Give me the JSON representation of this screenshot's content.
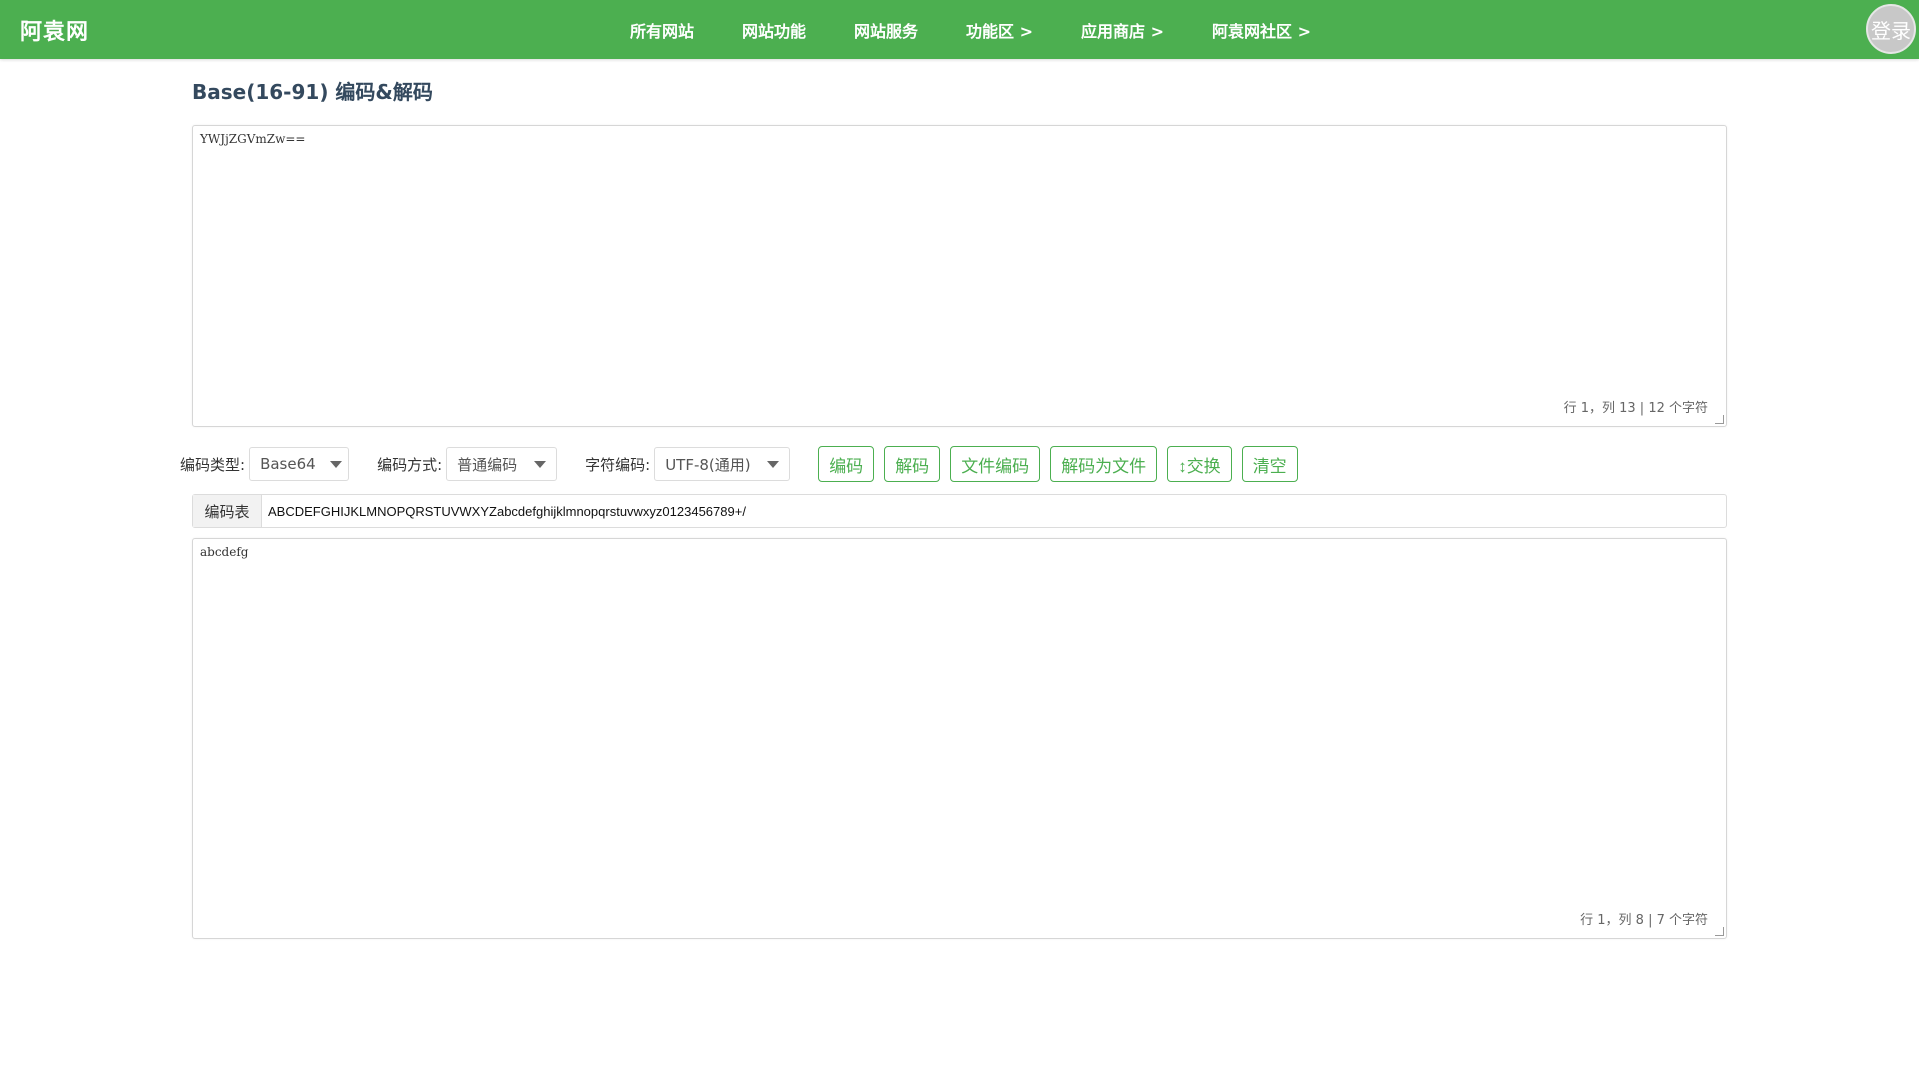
{
  "header": {
    "brand": "阿袁网",
    "nav": [
      "所有网站",
      "网站功能",
      "网站服务",
      "功能区 >",
      "应用商店 >",
      "阿袁网社区 >"
    ],
    "login_label": "登录"
  },
  "page": {
    "title": "Base(16-91) 编码&解码"
  },
  "input": {
    "value": "YWJjZGVmZw==",
    "status": "行 1，列 13 | 12 个字符"
  },
  "controls": {
    "encoding_type_label": "编码类型:",
    "encoding_type_value": "Base64",
    "encoding_method_label": "编码方式:",
    "encoding_method_value": "普通编码",
    "charset_label": "字符编码:",
    "charset_value": "UTF-8(通用)",
    "buttons": {
      "encode": "编码",
      "decode": "解码",
      "file_encode": "文件编码",
      "decode_to_file": "解码为文件",
      "swap": "↕交换",
      "clear": "清空"
    }
  },
  "alphabet": {
    "label": "编码表",
    "value": "ABCDEFGHIJKLMNOPQRSTUVWXYZabcdefghijklmnopqrstuvwxyz0123456789+/"
  },
  "output": {
    "value": "abcdefg",
    "status": "行 1，列 8 | 7 个字符"
  },
  "colors": {
    "accent": "#4caf50",
    "title": "#34495e"
  }
}
